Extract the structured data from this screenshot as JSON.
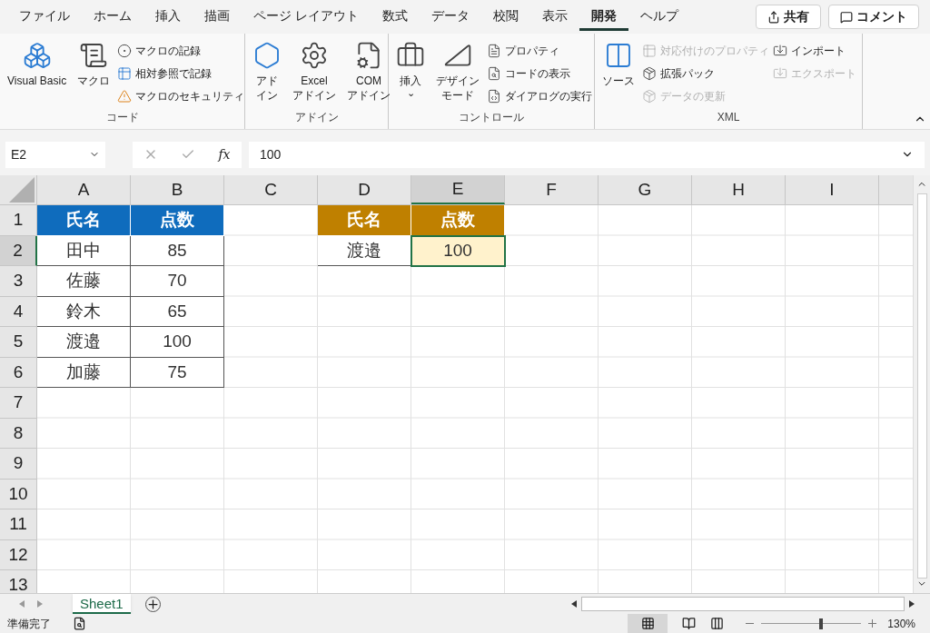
{
  "menu_tabs": [
    {
      "label": "ファイル",
      "selected": false
    },
    {
      "label": "ホーム",
      "selected": false
    },
    {
      "label": "挿入",
      "selected": false
    },
    {
      "label": "描画",
      "selected": false
    },
    {
      "label": "ページ レイアウト",
      "selected": false
    },
    {
      "label": "数式",
      "selected": false
    },
    {
      "label": "データ",
      "selected": false
    },
    {
      "label": "校閲",
      "selected": false
    },
    {
      "label": "表示",
      "selected": false
    },
    {
      "label": "開発",
      "selected": true
    },
    {
      "label": "ヘルプ",
      "selected": false
    }
  ],
  "share_button": "共有",
  "comment_button": "コメント",
  "ribbon_groups": [
    {
      "title": "コード",
      "items": [
        {
          "kind": "large",
          "lines": [
            "Visual Basic"
          ],
          "disabled": false
        },
        {
          "kind": "large",
          "lines": [
            "マクロ"
          ],
          "disabled": false
        },
        {
          "kind": "column",
          "items": [
            {
              "label": "マクロの記録",
              "disabled": false
            },
            {
              "label": "相対参照で記録",
              "disabled": false
            },
            {
              "label": "マクロのセキュリティ",
              "disabled": false
            }
          ]
        }
      ]
    },
    {
      "title": "アドイン",
      "items": [
        {
          "kind": "large",
          "lines": [
            "アド",
            "イン"
          ],
          "disabled": false
        },
        {
          "kind": "large",
          "lines": [
            "Excel",
            "アドイン"
          ],
          "disabled": false
        },
        {
          "kind": "large",
          "lines": [
            "COM",
            "アドイン"
          ],
          "disabled": false
        }
      ]
    },
    {
      "title": "コントロール",
      "items": [
        {
          "kind": "large",
          "lines": [
            "挿入"
          ],
          "dropdown": "⌄",
          "disabled": false
        },
        {
          "kind": "large",
          "lines": [
            "デザイン",
            "モード"
          ],
          "disabled": false
        },
        {
          "kind": "column",
          "items": [
            {
              "label": "プロパティ",
              "disabled": false
            },
            {
              "label": "コードの表示",
              "disabled": false
            },
            {
              "label": "ダイアログの実行",
              "disabled": false
            }
          ]
        }
      ]
    },
    {
      "title": "XML",
      "items": [
        {
          "kind": "large",
          "lines": [
            "ソース"
          ],
          "disabled": false
        },
        {
          "kind": "column",
          "items": [
            {
              "label": "対応付けのプロパティ",
              "disabled": true
            },
            {
              "label": "拡張パック",
              "disabled": false
            },
            {
              "label": "データの更新",
              "disabled": true
            }
          ]
        },
        {
          "kind": "column",
          "items": [
            {
              "label": "インポート",
              "disabled": false
            },
            {
              "label": "エクスポート",
              "disabled": true
            }
          ]
        }
      ]
    }
  ],
  "name_box": "E2",
  "function_button": "fx",
  "formula": "100",
  "columns": [
    {
      "label": "A",
      "selected": false
    },
    {
      "label": "B",
      "selected": false
    },
    {
      "label": "C",
      "selected": false
    },
    {
      "label": "D",
      "selected": false
    },
    {
      "label": "E",
      "selected": true
    },
    {
      "label": "F",
      "selected": false
    },
    {
      "label": "G",
      "selected": false
    },
    {
      "label": "H",
      "selected": false
    },
    {
      "label": "I",
      "selected": false
    }
  ],
  "rows": [
    {
      "label": "1",
      "selected": false,
      "cells": [
        {
          "text": "氏名",
          "kind": "header",
          "color": "#0f6cbd",
          "selected": false
        },
        {
          "text": "点数",
          "kind": "header",
          "color": "#0f6cbd",
          "selected": false
        },
        null,
        {
          "text": "氏名",
          "kind": "header",
          "color": "#bf8000",
          "selected": false
        },
        {
          "text": "点数",
          "kind": "header",
          "color": "#bf8000",
          "selected": false
        }
      ]
    },
    {
      "label": "2",
      "selected": true,
      "cells": [
        {
          "text": "田中",
          "kind": "data",
          "selected": false
        },
        {
          "text": "85",
          "kind": "data",
          "selected": false
        },
        null,
        {
          "text": "渡邉",
          "kind": "data",
          "selected": false
        },
        {
          "text": "100",
          "kind": "data",
          "color": "#fff2cc",
          "selected": true
        }
      ]
    },
    {
      "label": "3",
      "selected": false,
      "cells": [
        {
          "text": "佐藤",
          "kind": "data",
          "selected": false
        },
        {
          "text": "70",
          "kind": "data",
          "selected": false
        }
      ]
    },
    {
      "label": "4",
      "selected": false,
      "cells": [
        {
          "text": "鈴木",
          "kind": "data",
          "selected": false
        },
        {
          "text": "65",
          "kind": "data",
          "selected": false
        }
      ]
    },
    {
      "label": "5",
      "selected": false,
      "cells": [
        {
          "text": "渡邉",
          "kind": "data",
          "selected": false
        },
        {
          "text": "100",
          "kind": "data",
          "selected": false
        }
      ]
    },
    {
      "label": "6",
      "selected": false,
      "cells": [
        {
          "text": "加藤",
          "kind": "data",
          "selected": false
        },
        {
          "text": "75",
          "kind": "data",
          "selected": false
        }
      ]
    },
    {
      "label": "7",
      "selected": false,
      "cells": []
    },
    {
      "label": "8",
      "selected": false,
      "cells": []
    },
    {
      "label": "9",
      "selected": false,
      "cells": []
    },
    {
      "label": "10",
      "selected": false,
      "cells": []
    },
    {
      "label": "11",
      "selected": false,
      "cells": []
    },
    {
      "label": "12",
      "selected": false,
      "cells": []
    },
    {
      "label": "13",
      "selected": false,
      "cells": []
    }
  ],
  "sheets": [
    {
      "label": "Sheet1",
      "selected": true
    }
  ],
  "status": "準備完了",
  "zoom": {
    "level": 0.58,
    "label": "130%"
  }
}
